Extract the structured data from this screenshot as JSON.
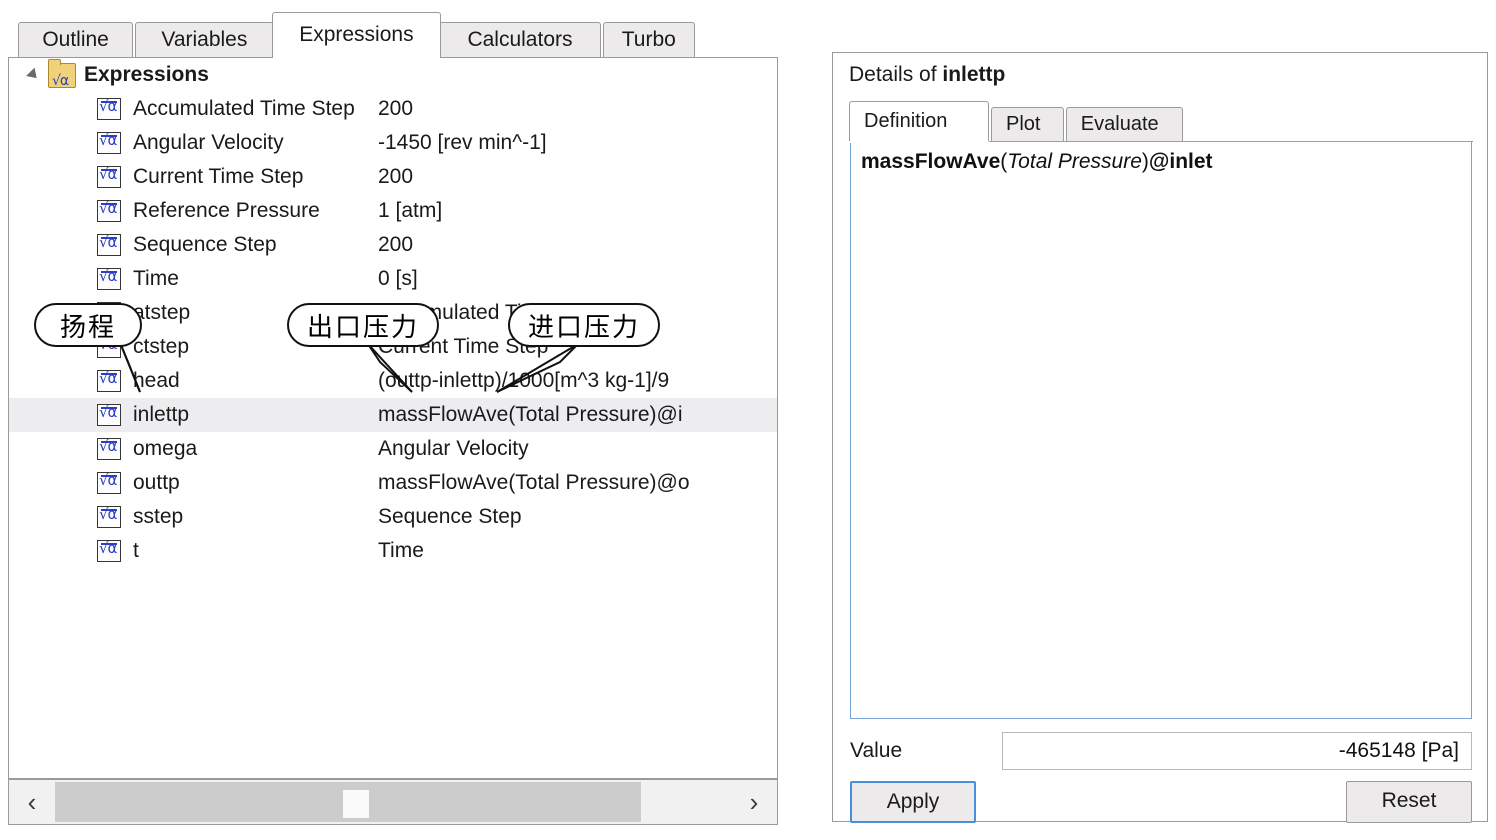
{
  "tabs": [
    {
      "label": "Outline",
      "active": false
    },
    {
      "label": "Variables",
      "active": false
    },
    {
      "label": "Expressions",
      "active": true
    },
    {
      "label": "Calculators",
      "active": false
    },
    {
      "label": "Turbo",
      "active": false
    }
  ],
  "tree": {
    "root_label": "Expressions",
    "root_icon": "expressions-folder-icon",
    "twisty_icon": "collapse-triangle-icon",
    "rows": [
      {
        "name": "Accumulated Time Step",
        "value": "200",
        "selected": false
      },
      {
        "name": "Angular Velocity",
        "value": "-1450 [rev min^-1]",
        "selected": false
      },
      {
        "name": "Current Time Step",
        "value": "200",
        "selected": false
      },
      {
        "name": "Reference Pressure",
        "value": "1 [atm]",
        "selected": false
      },
      {
        "name": "Sequence Step",
        "value": "200",
        "selected": false
      },
      {
        "name": "Time",
        "value": "0 [s]",
        "selected": false
      },
      {
        "name": "atstep",
        "value": "Accumulated Time Step",
        "selected": false
      },
      {
        "name": "ctstep",
        "value": "Current Time Step",
        "selected": false
      },
      {
        "name": "head",
        "value": "(outtp-inlettp)/1000[m^3 kg-1]/9",
        "selected": false
      },
      {
        "name": "inlettp",
        "value": "massFlowAve(Total Pressure)@i",
        "selected": true
      },
      {
        "name": "omega",
        "value": "Angular Velocity",
        "selected": false
      },
      {
        "name": "outtp",
        "value": "massFlowAve(Total Pressure)@o",
        "selected": false
      },
      {
        "name": "sstep",
        "value": "Sequence Step",
        "selected": false
      },
      {
        "name": "t",
        "value": "Time",
        "selected": false
      }
    ]
  },
  "scrollbar": {
    "left_arrow": "‹",
    "right_arrow": "›"
  },
  "callouts": [
    {
      "text": "扬程",
      "target": "head"
    },
    {
      "text": "出口压力",
      "target": "outtp"
    },
    {
      "text": "进口压力",
      "target": "inlettp"
    }
  ],
  "details": {
    "title_prefix": "Details of ",
    "title_name": "inlettp",
    "tabs": [
      {
        "label": "Definition",
        "active": true
      },
      {
        "label": "Plot",
        "active": false
      },
      {
        "label": "Evaluate",
        "active": false
      }
    ],
    "definition": {
      "function": "massFlowAve",
      "open_paren": "(",
      "variable": "Total Pressure",
      "close_paren": ")",
      "location": "@inlet"
    },
    "value_label": "Value",
    "value": "-465148 [Pa]",
    "apply_label": "Apply",
    "reset_label": "Reset"
  },
  "colors": {
    "accent": "#4a90d9",
    "selection": "#ededf0",
    "tab_inactive": "#eceaea",
    "border": "#9a9a9a",
    "icon_blue": "#2b3fc4"
  }
}
